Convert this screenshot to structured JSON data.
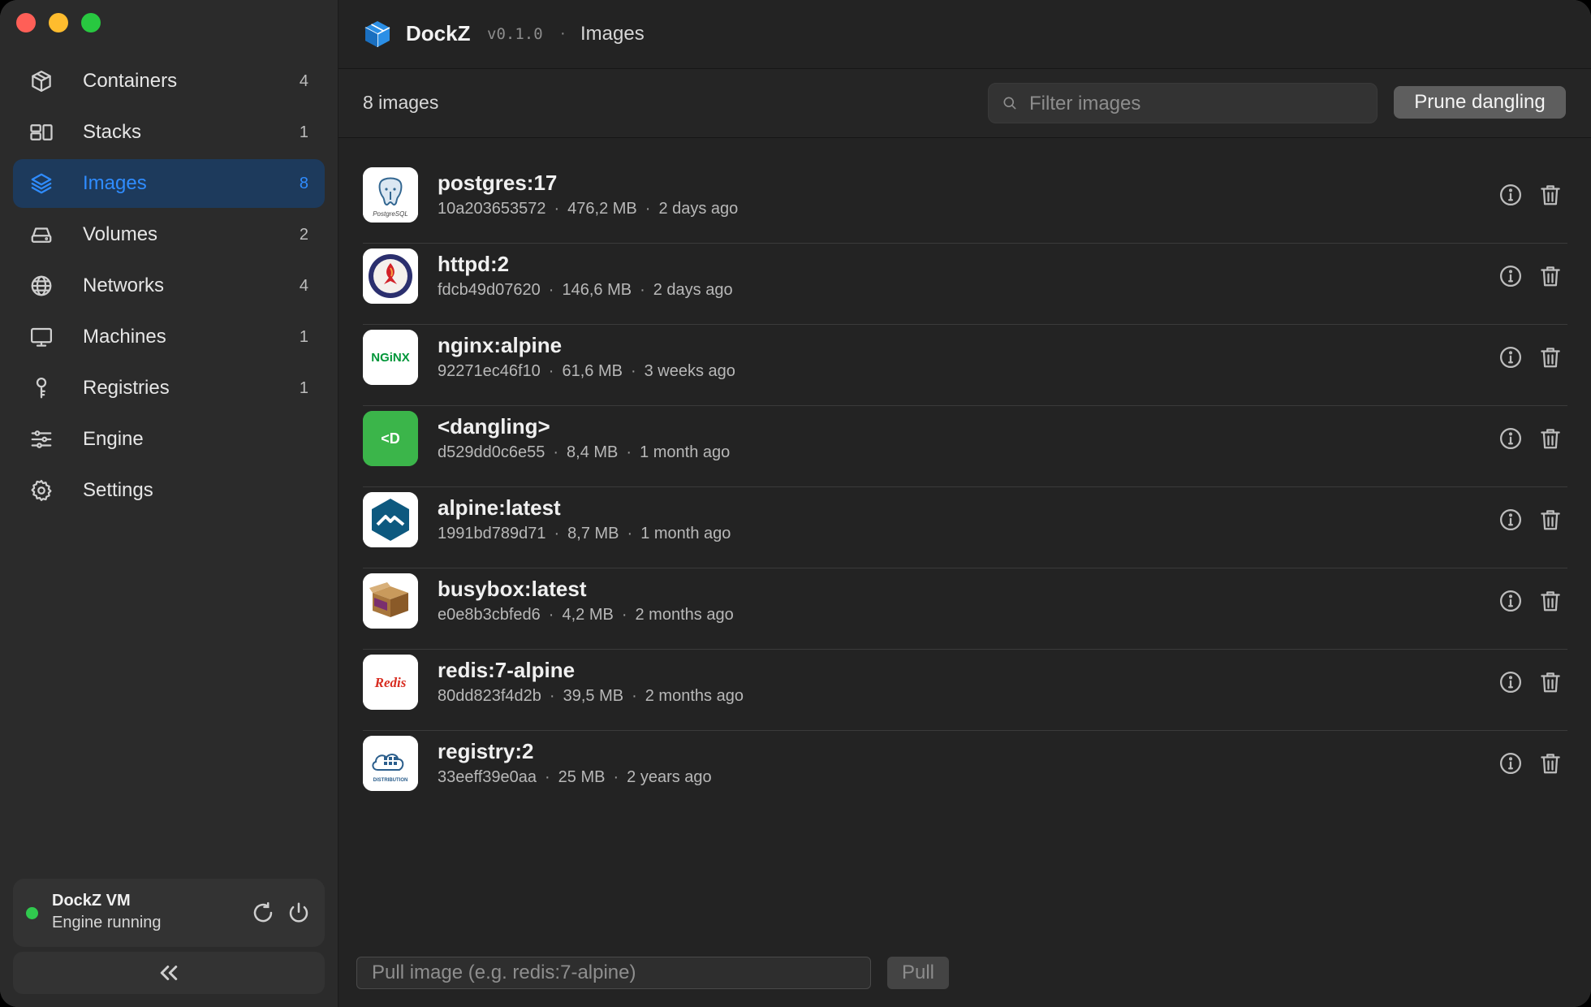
{
  "window": {
    "traffic_lights": [
      "close",
      "minimize",
      "zoom"
    ]
  },
  "sidebar": {
    "items": [
      {
        "label": "Containers",
        "count": "4",
        "icon": "box-icon",
        "active": false
      },
      {
        "label": "Stacks",
        "count": "1",
        "icon": "stacks-icon",
        "active": false
      },
      {
        "label": "Images",
        "count": "8",
        "icon": "layers-icon",
        "active": true
      },
      {
        "label": "Volumes",
        "count": "2",
        "icon": "drive-icon",
        "active": false
      },
      {
        "label": "Networks",
        "count": "4",
        "icon": "globe-icon",
        "active": false
      },
      {
        "label": "Machines",
        "count": "1",
        "icon": "monitor-icon",
        "active": false
      },
      {
        "label": "Registries",
        "count": "1",
        "icon": "key-icon",
        "active": false
      },
      {
        "label": "Engine",
        "count": "",
        "icon": "sliders-icon",
        "active": false
      },
      {
        "label": "Settings",
        "count": "",
        "icon": "gear-icon",
        "active": false
      }
    ],
    "vm": {
      "name": "DockZ VM",
      "status": "Engine running",
      "status_color": "#30c94e"
    }
  },
  "header": {
    "app_name": "DockZ",
    "version": "v0.1.0",
    "separator": "·",
    "breadcrumb": "Images"
  },
  "toolbar": {
    "count_label": "8 images",
    "filter_placeholder": "Filter images",
    "filter_value": "",
    "prune_label": "Prune dangling"
  },
  "images": [
    {
      "name": "postgres:17",
      "id": "10a203653572",
      "size": "476,2 MB",
      "age": "2 days ago",
      "logo": "postgres-logo"
    },
    {
      "name": "httpd:2",
      "id": "fdcb49d07620",
      "size": "146,6 MB",
      "age": "2 days ago",
      "logo": "apache-logo"
    },
    {
      "name": "nginx:alpine",
      "id": "92271ec46f10",
      "size": "61,6 MB",
      "age": "3 weeks ago",
      "logo": "nginx-logo",
      "logo_text": "NGiNX"
    },
    {
      "name": "<dangling>",
      "id": "d529dd0c6e55",
      "size": "8,4 MB",
      "age": "1 month ago",
      "logo": "dangling-logo",
      "logo_text": "<D"
    },
    {
      "name": "alpine:latest",
      "id": "1991bd789d71",
      "size": "8,7 MB",
      "age": "1 month ago",
      "logo": "alpine-logo"
    },
    {
      "name": "busybox:latest",
      "id": "e0e8b3cbfed6",
      "size": "4,2 MB",
      "age": "2 months ago",
      "logo": "busybox-logo"
    },
    {
      "name": "redis:7-alpine",
      "id": "80dd823f4d2b",
      "size": "39,5 MB",
      "age": "2 months ago",
      "logo": "redis-logo",
      "logo_text": "Redis"
    },
    {
      "name": "registry:2",
      "id": "33eeff39e0aa",
      "size": "25 MB",
      "age": "2 years ago",
      "logo": "distribution-logo",
      "logo_text": "DISTRIBUTION"
    }
  ],
  "meta_separator": "·",
  "pull": {
    "placeholder": "Pull image (e.g. redis:7-alpine)",
    "value": "",
    "button_label": "Pull"
  },
  "colors": {
    "accent": "#2f8cff",
    "active_bg": "#1d3a5c",
    "dangling_green": "#3bb54a"
  }
}
